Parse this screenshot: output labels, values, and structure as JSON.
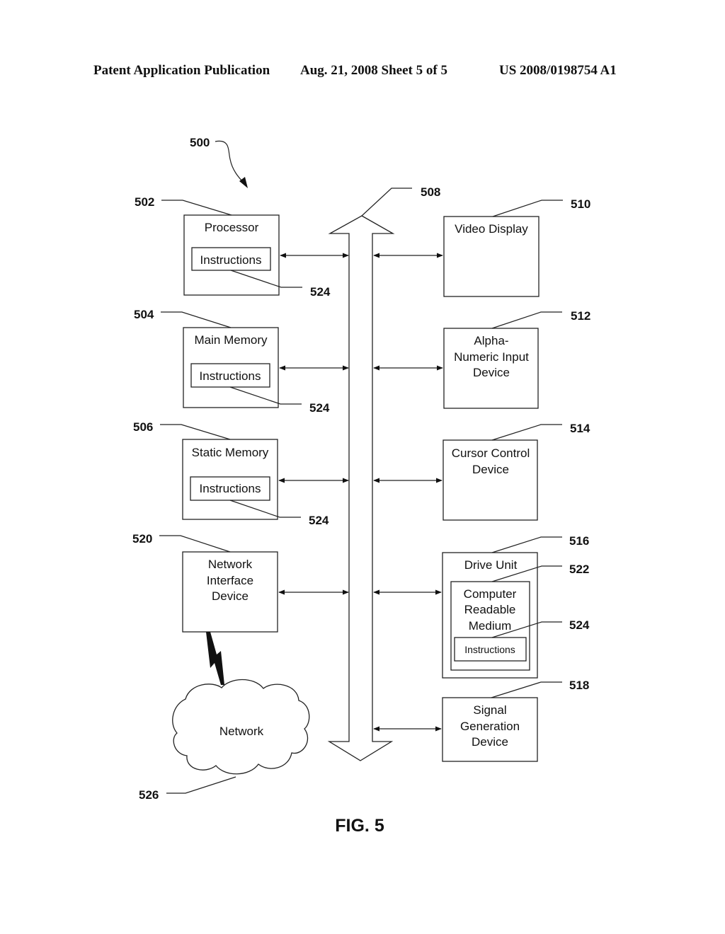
{
  "header": {
    "publication": "Patent Application Publication",
    "date_sheet": "Aug. 21, 2008  Sheet 5 of 5",
    "number": "US 2008/0198754 A1"
  },
  "figure": {
    "caption": "FIG. 5",
    "system_ref": "500",
    "bus_ref": "508",
    "left_components": [
      {
        "ref": "502",
        "label": "Processor",
        "inner": "Instructions",
        "inner_ref": "524"
      },
      {
        "ref": "504",
        "label": "Main Memory",
        "inner": "Instructions",
        "inner_ref": "524"
      },
      {
        "ref": "506",
        "label": "Static Memory",
        "inner": "Instructions",
        "inner_ref": "524"
      },
      {
        "ref": "520",
        "label_lines": [
          "Network",
          "Interface",
          "Device"
        ]
      }
    ],
    "right_components": [
      {
        "ref": "510",
        "label_lines": [
          "Video Display"
        ]
      },
      {
        "ref": "512",
        "label_lines": [
          "Alpha-",
          "Numeric Input",
          "Device"
        ]
      },
      {
        "ref": "514",
        "label_lines": [
          "Cursor Control",
          "Device"
        ]
      },
      {
        "ref": "516",
        "label": "Drive Unit",
        "medium_ref": "522",
        "medium_lines": [
          "Computer",
          "Readable",
          "Medium"
        ],
        "inner": "Instructions",
        "inner_ref": "524"
      },
      {
        "ref": "518",
        "label_lines": [
          "Signal",
          "Generation",
          "Device"
        ]
      }
    ],
    "network": {
      "ref": "526",
      "label": "Network"
    }
  }
}
